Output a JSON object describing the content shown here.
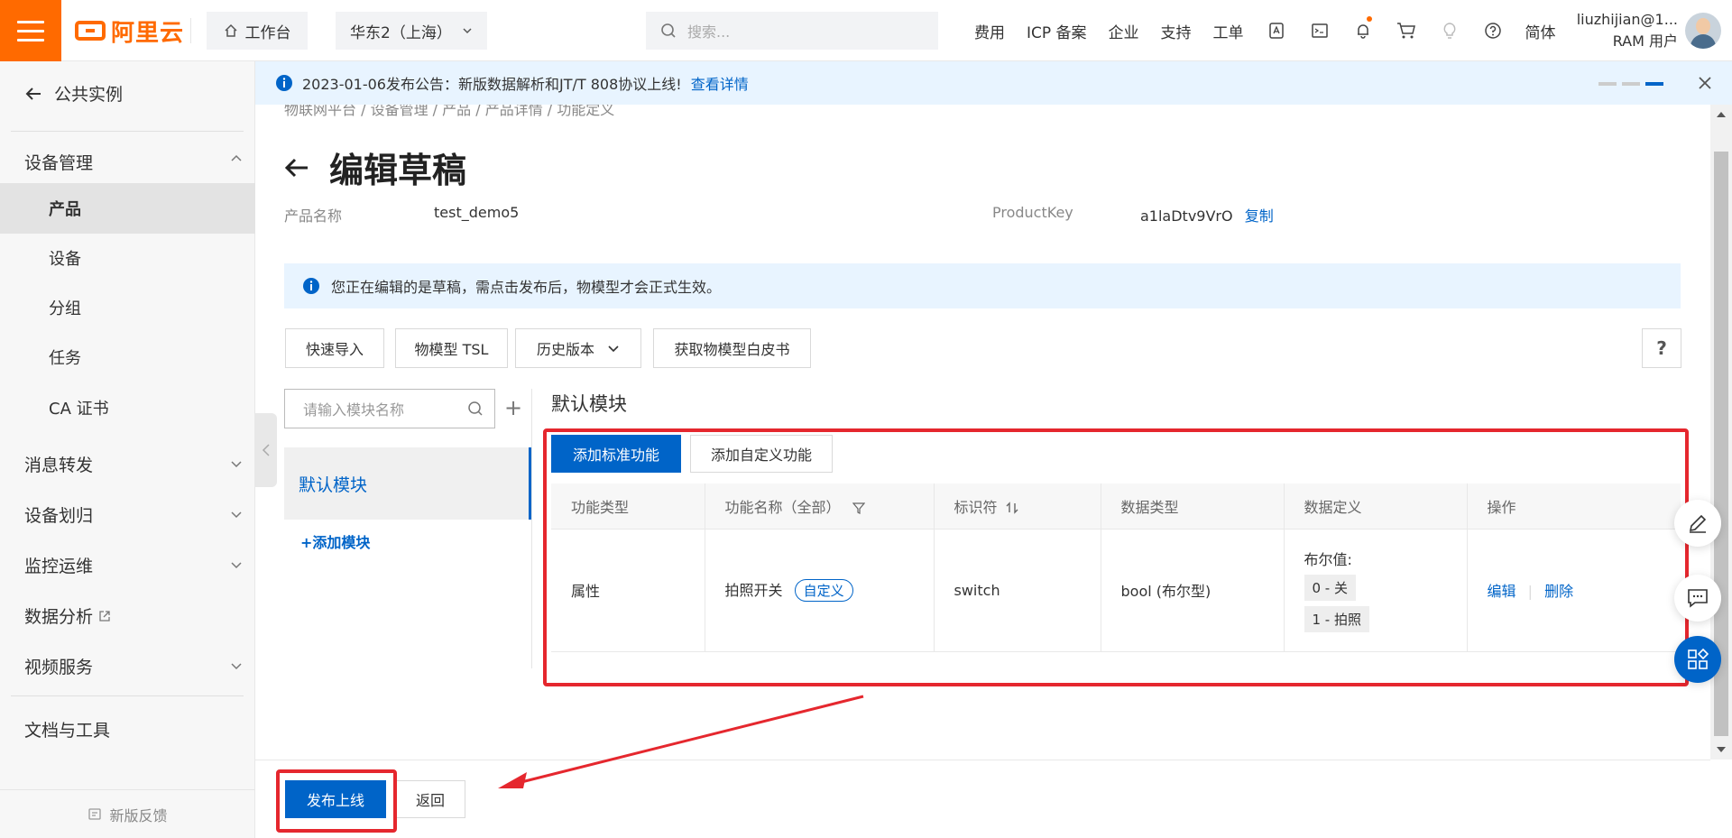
{
  "topbar": {
    "logo_text": "阿里云",
    "workbench_label": "工作台",
    "region_label": "华东2（上海）",
    "search_placeholder": "搜索...",
    "nav_items": [
      "费用",
      "ICP 备案",
      "企业",
      "支持",
      "工单"
    ],
    "lang_label": "简体",
    "user_name": "liuzhijian@1...",
    "user_role": "RAM 用户"
  },
  "sidebar": {
    "back_label": "公共实例",
    "device_mgmt_label": "设备管理",
    "sub_items": [
      "产品",
      "设备",
      "分组",
      "任务",
      "CA 证书"
    ],
    "group_items": [
      "消息转发",
      "设备划归",
      "监控运维",
      "数据分析",
      "视频服务"
    ],
    "docs_label": "文档与工具",
    "feedback_label": "新版反馈"
  },
  "notice": {
    "text": "2023-01-06发布公告：新版数据解析和JT/T 808协议上线!",
    "link": "查看详情"
  },
  "page": {
    "breadcrumb": "物联网平台  /  设备管理  /  产品  /  产品详情  /  功能定义",
    "title": "编辑草稿",
    "product_name_label": "产品名称",
    "product_name_value": "test_demo5",
    "product_key_label": "ProductKey",
    "product_key_value": "a1laDtv9VrO",
    "copy_label": "复制",
    "draft_tip": "您正在编辑的是草稿，需点击发布后，物模型才会正式生效。",
    "toolbar": {
      "quick_import": "快速导入",
      "tsl": "物模型 TSL",
      "history": "历史版本",
      "whitepaper": "获取物模型白皮书",
      "help": "?"
    }
  },
  "modules": {
    "search_placeholder": "请输入模块名称",
    "items": [
      "默认模块"
    ],
    "add_label": "+添加模块",
    "current_title": "默认模块",
    "add_standard": "添加标准功能",
    "add_custom": "添加自定义功能"
  },
  "table": {
    "headers": [
      "功能类型",
      "功能名称（全部）",
      "标识符",
      "数据类型",
      "数据定义",
      "操作"
    ],
    "rows": [
      {
        "type": "属性",
        "name": "拍照开关",
        "tag": "自定义",
        "identifier": "switch",
        "data_type": "bool (布尔型)",
        "def_label": "布尔值:",
        "def_values": [
          "0 - 关",
          "1 - 拍照"
        ],
        "edit": "编辑",
        "delete": "删除"
      }
    ]
  },
  "footer": {
    "publish_label": "发布上线",
    "back_label": "返回"
  },
  "colors": {
    "brand": "#ff6a00",
    "primary": "#0064c8",
    "annotation": "#e5272e"
  }
}
